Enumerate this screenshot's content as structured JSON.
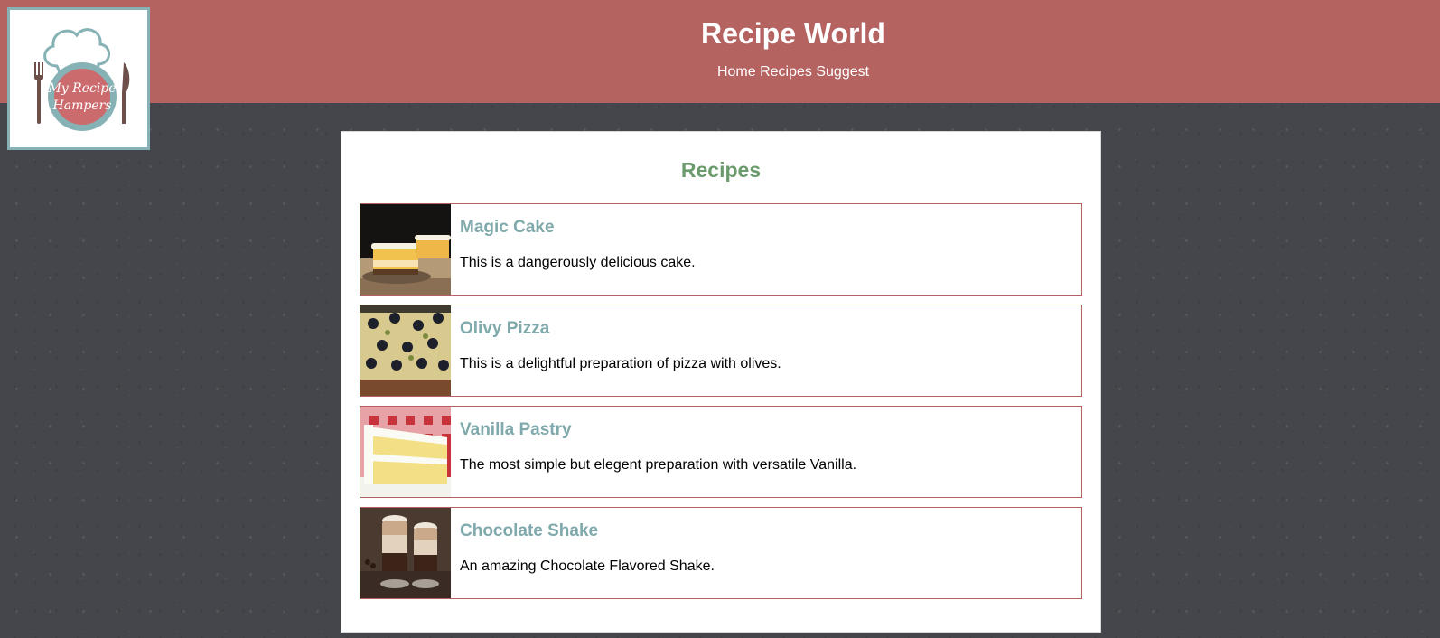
{
  "site": {
    "title": "Recipe World",
    "logo_text_line1": "My Recipe",
    "logo_text_line2": "Hampers"
  },
  "nav": {
    "items": [
      {
        "label": "Home"
      },
      {
        "label": "Recipes"
      },
      {
        "label": "Suggest"
      }
    ]
  },
  "main": {
    "heading": "Recipes",
    "recipes": [
      {
        "name": "Magic Cake",
        "description": "This is a dangerously delicious cake.",
        "image_icon": "cake-slice-image"
      },
      {
        "name": "Olivy Pizza",
        "description": "This is a delightful preparation of pizza with olives.",
        "image_icon": "pizza-image"
      },
      {
        "name": "Vanilla Pastry",
        "description": "The most simple but elegent preparation with versatile Vanilla.",
        "image_icon": "vanilla-cake-image"
      },
      {
        "name": "Chocolate Shake",
        "description": "An amazing Chocolate Flavored Shake.",
        "image_icon": "shake-glasses-image"
      }
    ]
  },
  "colors": {
    "header_bg": "#b46361",
    "page_bg": "#45464b",
    "heading_green": "#6b9b6d",
    "recipe_title_teal": "#7fa9ab",
    "card_border": "#b46361"
  }
}
